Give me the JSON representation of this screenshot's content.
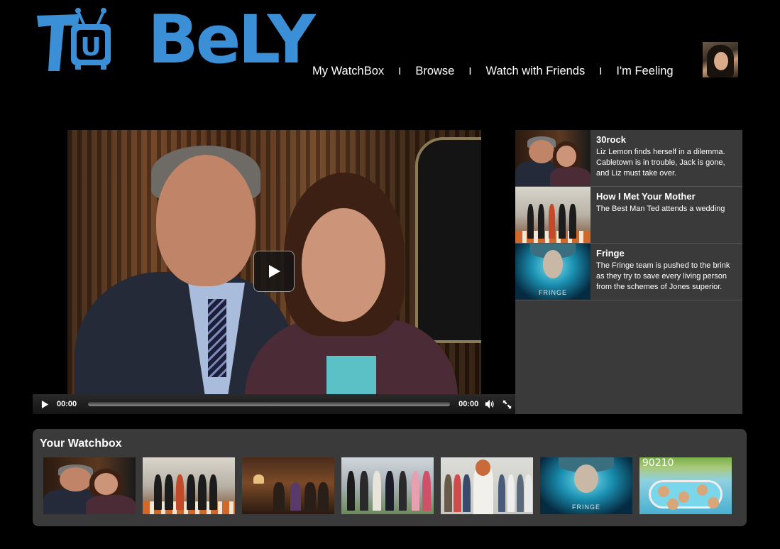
{
  "app": {
    "logo_text": "TuBely",
    "logo_tv_letter": "U",
    "brand_color": "#3a8fd6"
  },
  "nav": {
    "items": [
      {
        "label": "My WatchBox"
      },
      {
        "label": "Browse"
      },
      {
        "label": "Watch with Friends"
      },
      {
        "label": "I'm Feeling"
      }
    ],
    "separator": "I"
  },
  "player": {
    "current_time": "00:00",
    "duration": "00:00",
    "progress": 0,
    "icons": [
      "play-icon",
      "volume-icon",
      "fullscreen-icon"
    ]
  },
  "playlist": {
    "items": [
      {
        "title": "30rock",
        "description": "Liz Lemon finds herself in a dilemma. Cabletown is in trouble, Jack is gone, and Liz must take over."
      },
      {
        "title": "How I Met Your Mother",
        "description": "The Best Man Ted attends a wedding"
      },
      {
        "title": "Fringe",
        "description": "The Fringe team is pushed to the brink as they try to save every living person from the schemes of Jones superior."
      }
    ]
  },
  "thumb_text": {
    "fringe": "FRINGE",
    "ninety": "90210"
  },
  "watchbox": {
    "title": "Your Watchbox"
  }
}
